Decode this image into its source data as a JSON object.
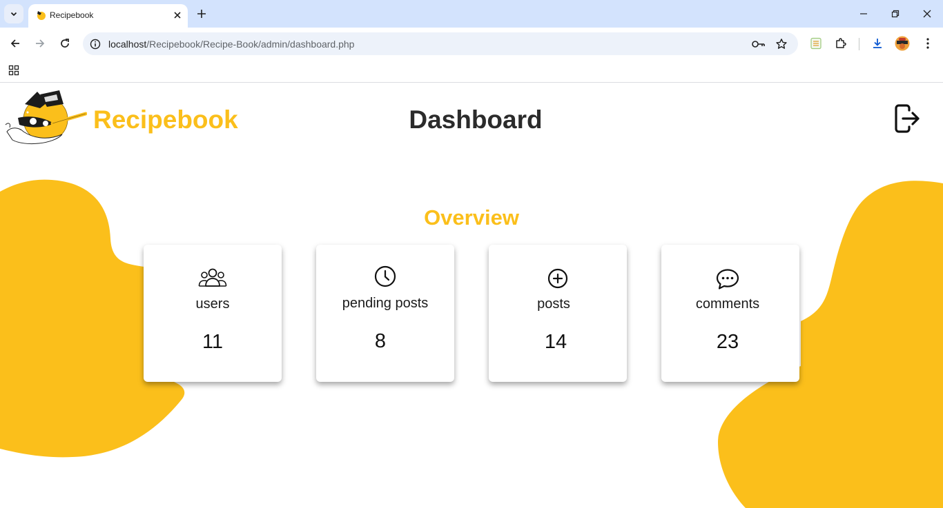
{
  "browser": {
    "tab": {
      "title": "Recipebook"
    },
    "url": {
      "host": "localhost",
      "path": "/Recipebook/Recipe-Book/admin/dashboard.php"
    }
  },
  "header": {
    "logo_text": "Recipebook",
    "page_title": "Dashboard",
    "logout_icon": "logout-icon"
  },
  "overview": {
    "title": "Overview",
    "cards": [
      {
        "icon": "users-icon",
        "label": "users",
        "value": "11"
      },
      {
        "icon": "clock-icon",
        "label": "pending posts",
        "value": "8"
      },
      {
        "icon": "plus-circle-icon",
        "label": "posts",
        "value": "14"
      },
      {
        "icon": "chat-bubble-icon",
        "label": "comments",
        "value": "23"
      }
    ]
  },
  "colors": {
    "brand_yellow": "#fbbf1b",
    "title_dark": "#2b2b2b",
    "tabbar_bg": "#d3e3fd"
  }
}
